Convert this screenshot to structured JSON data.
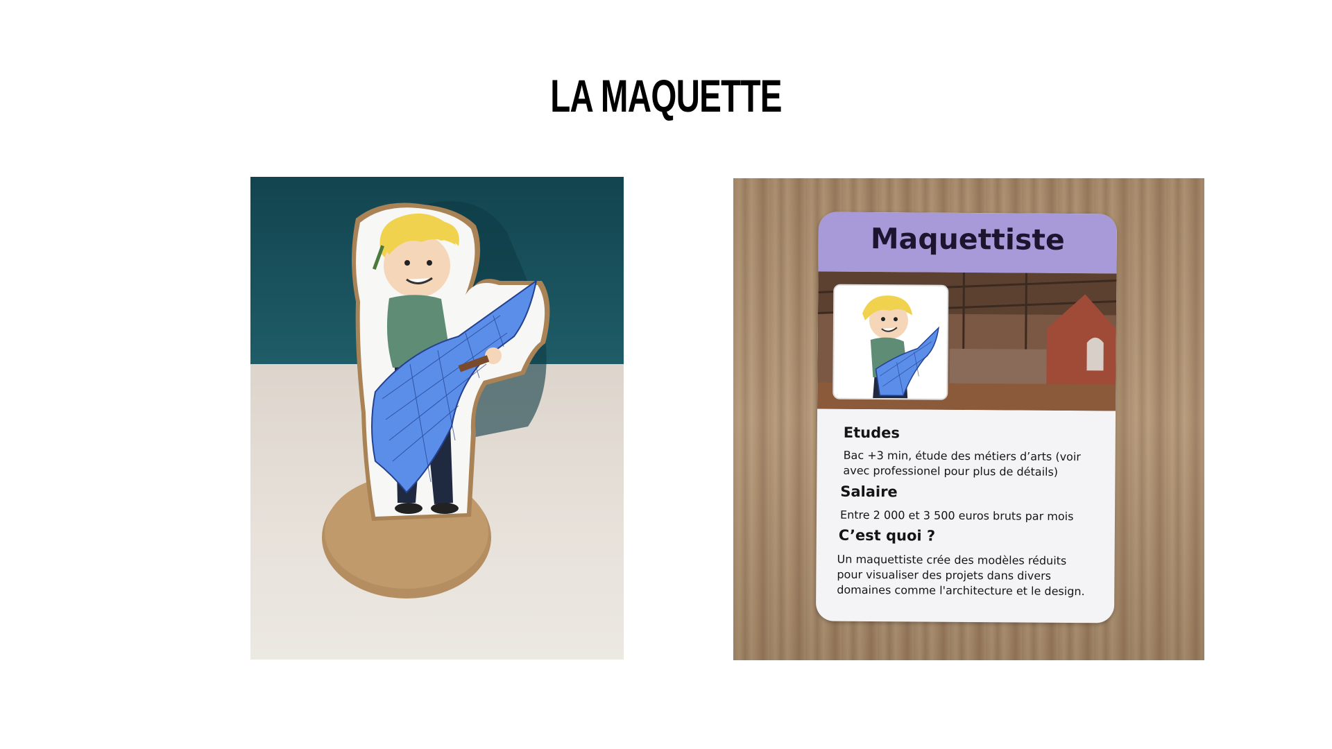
{
  "slide": {
    "title": "LA MAQUETTE"
  },
  "card": {
    "title": "Maquettiste",
    "sections": [
      {
        "heading": "Etudes",
        "text": "Bac +3 min, étude des métiers d’arts (voir avec professionel pour plus de détails)"
      },
      {
        "heading": "Salaire",
        "text": "Entre 2 000 et 3 500 euros bruts par mois"
      },
      {
        "heading": "C’est quoi ?",
        "text": "Un maquettiste crée des modèles réduits pour visualiser des projets dans divers domaines comme l'architecture et le design."
      }
    ]
  },
  "colors": {
    "card_header": "#a89ad8",
    "wall": "#1f5a66",
    "cardboard": "#b48e60",
    "blueprint": "#5b8ee8"
  }
}
